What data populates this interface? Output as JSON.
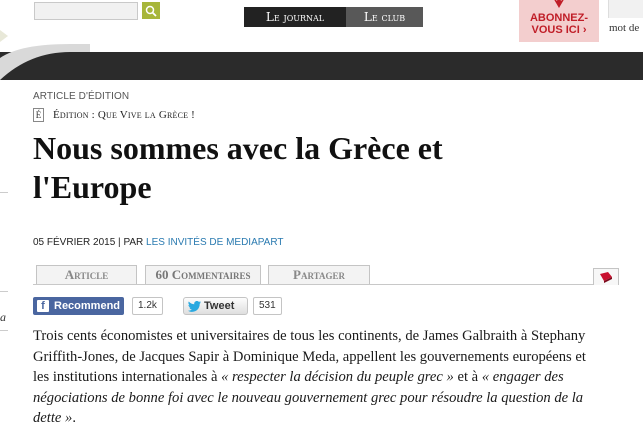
{
  "header": {
    "search_placeholder": "",
    "tabs": [
      "Le journal",
      "Le club"
    ],
    "subscribe": {
      "line1": "ABONNEZ-",
      "line2": "VOUS ICI ›"
    },
    "right_snippet": "mot de"
  },
  "article": {
    "type_label": "ARTICLE D'ÉDITION",
    "edition_icon": "É",
    "edition_label": "Édition : Que Vive la Grèce !",
    "title": "Nous sommes avec la Grèce et l'Europe",
    "date": "05 FÉVRIER 2015",
    "by_prefix": "PAR",
    "author": "LES INVITÉS DE MEDIAPART",
    "tabs": {
      "article": "Article",
      "comments": "60 Commentaires",
      "share": "Partager"
    },
    "social": {
      "fb_label": "Recommend",
      "fb_count": "1.2k",
      "tw_label": "Tweet",
      "tw_count": "531"
    },
    "left_fragment": "a",
    "body": {
      "p1": "Trois cents économistes et universitaires de tous les continents, de James Galbraith à Stephany Griffith-Jones, de Jacques Sapir à Dominique Meda, appellent les gouvernements européens et les institutions internationales à ",
      "q1": "« respecter la décision du peuple grec »",
      "p2": " et à ",
      "q2": "« engager des négociations de bonne foi avec le nouveau gouvernement grec pour résoudre la question de la dette »",
      "p3": "."
    }
  },
  "colors": {
    "dark_band": "#2b2b2b",
    "author_link": "#2a7ab0",
    "facebook": "#4a66a0",
    "subscribe_red": "#c01e28",
    "search_green": "#a7b63a"
  }
}
